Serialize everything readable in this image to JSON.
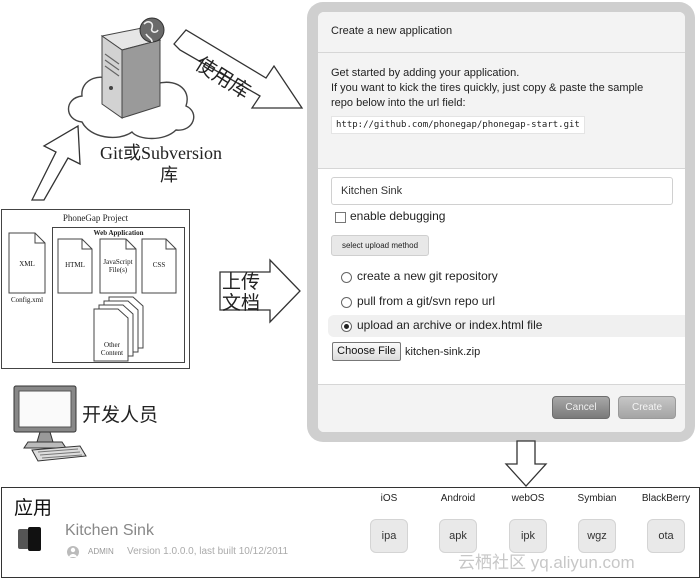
{
  "server": {
    "vcs_label_line1": "Git或Subversion",
    "vcs_label_line2": "库",
    "use_repo_label": "使用库"
  },
  "upload_label": {
    "line1": "上传",
    "line2": "文档"
  },
  "developer_label": "开发人员",
  "project": {
    "title": "PhoneGap Project",
    "config_label": "XML",
    "config_file": "Config.xml",
    "web_app_title": "Web Application",
    "files": [
      {
        "name": "HTML"
      },
      {
        "name": "JavaScript File(s)"
      },
      {
        "name": "CSS"
      }
    ],
    "other_content": "Other Content"
  },
  "dialog": {
    "title": "Create a new application",
    "intro_line1": "Get started by adding your application.",
    "intro_line2": "If you want to kick the tires quickly, just copy & paste the sample",
    "intro_line3": "repo below into the url field:",
    "sample_url": "http://github.com/phonegap/phonegap-start.git",
    "app_name_value": "Kitchen Sink",
    "debug_label": "enable debugging",
    "upload_method_button": "select upload method",
    "options": [
      {
        "label": "create a new git repository",
        "selected": false
      },
      {
        "label": "pull from a git/svn repo url",
        "selected": false
      },
      {
        "label": "upload an archive or index.html file",
        "selected": true
      }
    ],
    "choose_file_button": "Choose File",
    "chosen_file": "kitchen-sink.zip",
    "cancel_button": "Cancel",
    "create_button": "Create"
  },
  "apps_panel": {
    "title": "应用",
    "app_name": "Kitchen Sink",
    "role_badge": "ADMIN",
    "version_info": "Version 1.0.0.0, last built 10/12/2011",
    "platforms": [
      {
        "name": "iOS",
        "package": "ipa"
      },
      {
        "name": "Android",
        "package": "apk"
      },
      {
        "name": "webOS",
        "package": "ipk"
      },
      {
        "name": "Symbian",
        "package": "wgz"
      },
      {
        "name": "BlackBerry",
        "package": "ota"
      }
    ]
  },
  "watermark": "云栖社区 yq.aliyun.com",
  "colors": {
    "dialog_frame": "#cfcfcf",
    "panel_bg": "#f3f3f3",
    "button_grey": "#8a8a8a"
  }
}
